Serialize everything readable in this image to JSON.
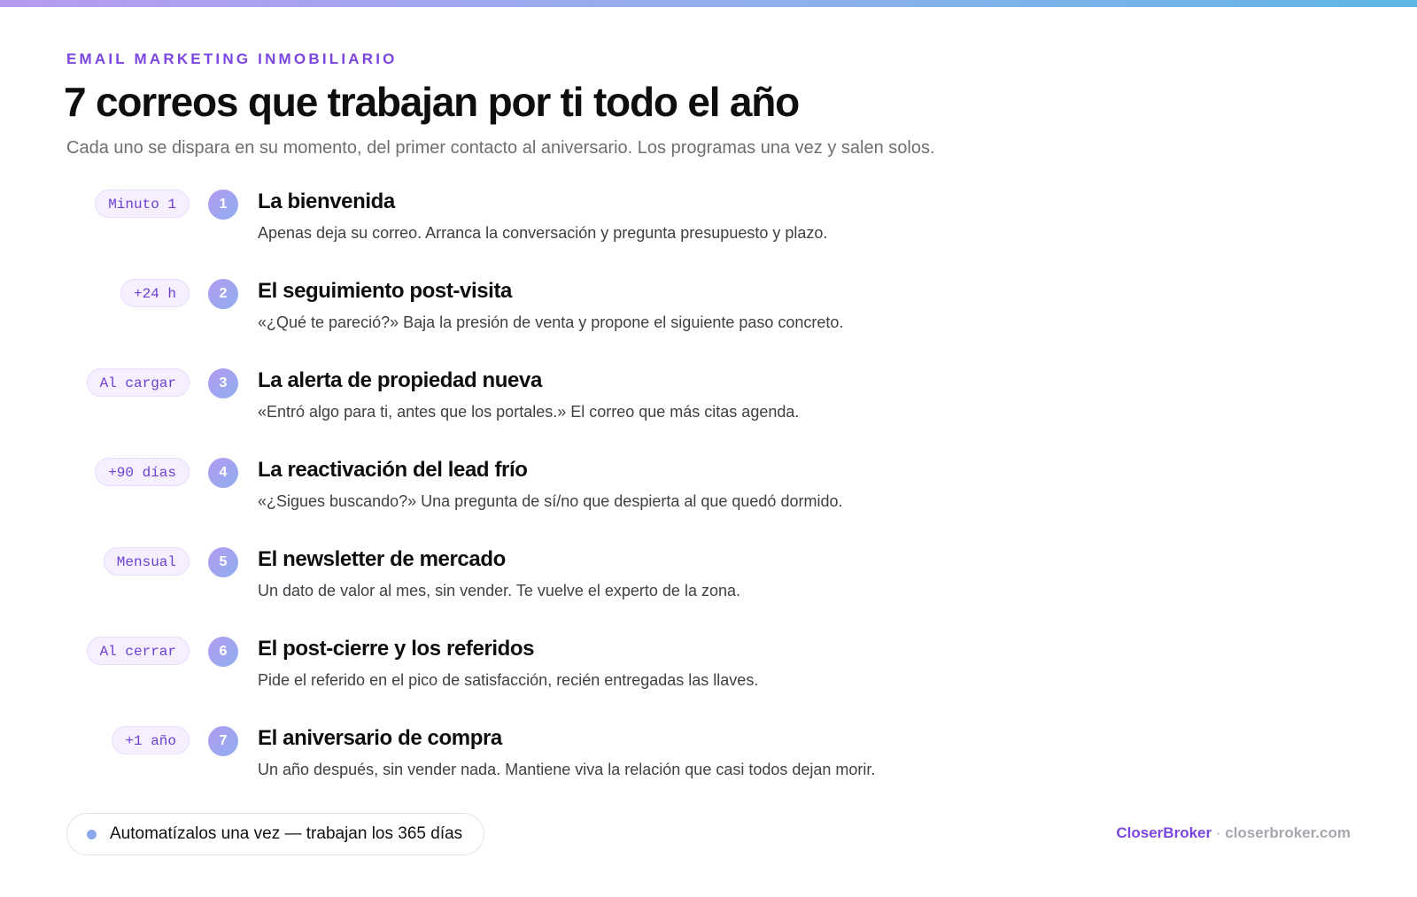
{
  "header": {
    "eyebrow": "EMAIL MARKETING INMOBILIARIO",
    "title": "7 correos que trabajan por ti todo el año",
    "subtitle": "Cada uno se dispara en su momento, del primer contacto al aniversario. Los programas una vez y salen solos."
  },
  "steps": [
    {
      "num": "1",
      "timing": "Minuto 1",
      "title": "La bienvenida",
      "desc": "Apenas deja su correo. Arranca la conversación y pregunta presupuesto y plazo."
    },
    {
      "num": "2",
      "timing": "+24 h",
      "title": "El seguimiento post-visita",
      "desc": "«¿Qué te pareció?» Baja la presión de venta y propone el siguiente paso concreto."
    },
    {
      "num": "3",
      "timing": "Al cargar",
      "title": "La alerta de propiedad nueva",
      "desc": "«Entró algo para ti, antes que los portales.» El correo que más citas agenda."
    },
    {
      "num": "4",
      "timing": "+90 días",
      "title": "La reactivación del lead frío",
      "desc": "«¿Sigues buscando?» Una pregunta de sí/no que despierta al que quedó dormido."
    },
    {
      "num": "5",
      "timing": "Mensual",
      "title": "El newsletter de mercado",
      "desc": "Un dato de valor al mes, sin vender. Te vuelve el experto de la zona."
    },
    {
      "num": "6",
      "timing": "Al cerrar",
      "title": "El post-cierre y los referidos",
      "desc": "Pide el referido en el pico de satisfacción, recién entregadas las llaves."
    },
    {
      "num": "7",
      "timing": "+1 año",
      "title": "El aniversario de compra",
      "desc": "Un año después, sin vender nada. Mantiene viva la relación que casi todos dejan morir."
    }
  ],
  "cta": {
    "text": "Automatízalos una vez — trabajan los 365 días"
  },
  "footer": {
    "brand": "CloserBroker",
    "separator": "·",
    "domain": "closerbroker.com"
  },
  "colors": {
    "accent": "#7b45df",
    "pill_bg": "#f5efff",
    "gradient_start": "#b79af2",
    "gradient_end": "#5fb6e6"
  }
}
